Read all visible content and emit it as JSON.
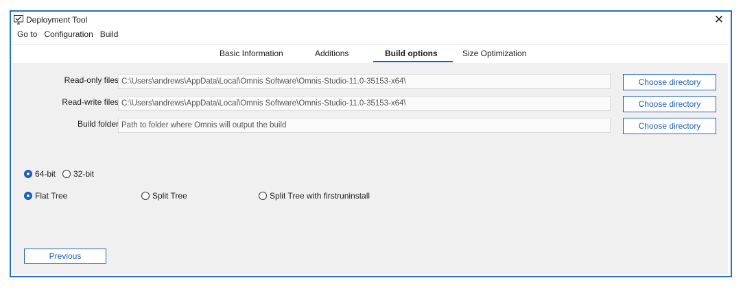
{
  "window": {
    "title": "Deployment Tool",
    "close_glyph": "✕"
  },
  "menu": [
    "Go to",
    "Configuration",
    "Build"
  ],
  "tabs": [
    "Basic Information",
    "Additions",
    "Build options",
    "Size Optimization"
  ],
  "active_tab": "Build options",
  "fields": [
    {
      "label": "Read-only files",
      "value": "C:\\Users\\andrews\\AppData\\Local\\Omnis Software\\Omnis-Studio-11.0-35153-x64\\",
      "button": "Choose directory"
    },
    {
      "label": "Read-write files",
      "value": "C:\\Users\\andrews\\AppData\\Local\\Omnis Software\\Omnis-Studio-11.0-35153-x64\\",
      "button": "Choose directory"
    },
    {
      "label": "Build folder",
      "placeholder": "Path to folder where Omnis will output the build",
      "button": "Choose directory"
    }
  ],
  "architecture": {
    "options": [
      "64-bit",
      "32-bit"
    ],
    "selected": "64-bit"
  },
  "tree": {
    "options": [
      "Flat Tree",
      "Split Tree",
      "Split Tree with firstruninstall"
    ],
    "selected": "Flat Tree"
  },
  "previous_label": "Previous",
  "colors": {
    "accent": "#1b5fbd",
    "window_border": "#1f6fc5",
    "content_bg": "#f0f0f0"
  },
  "icons": {
    "app": "monitor-check-icon",
    "close": "close-icon"
  }
}
